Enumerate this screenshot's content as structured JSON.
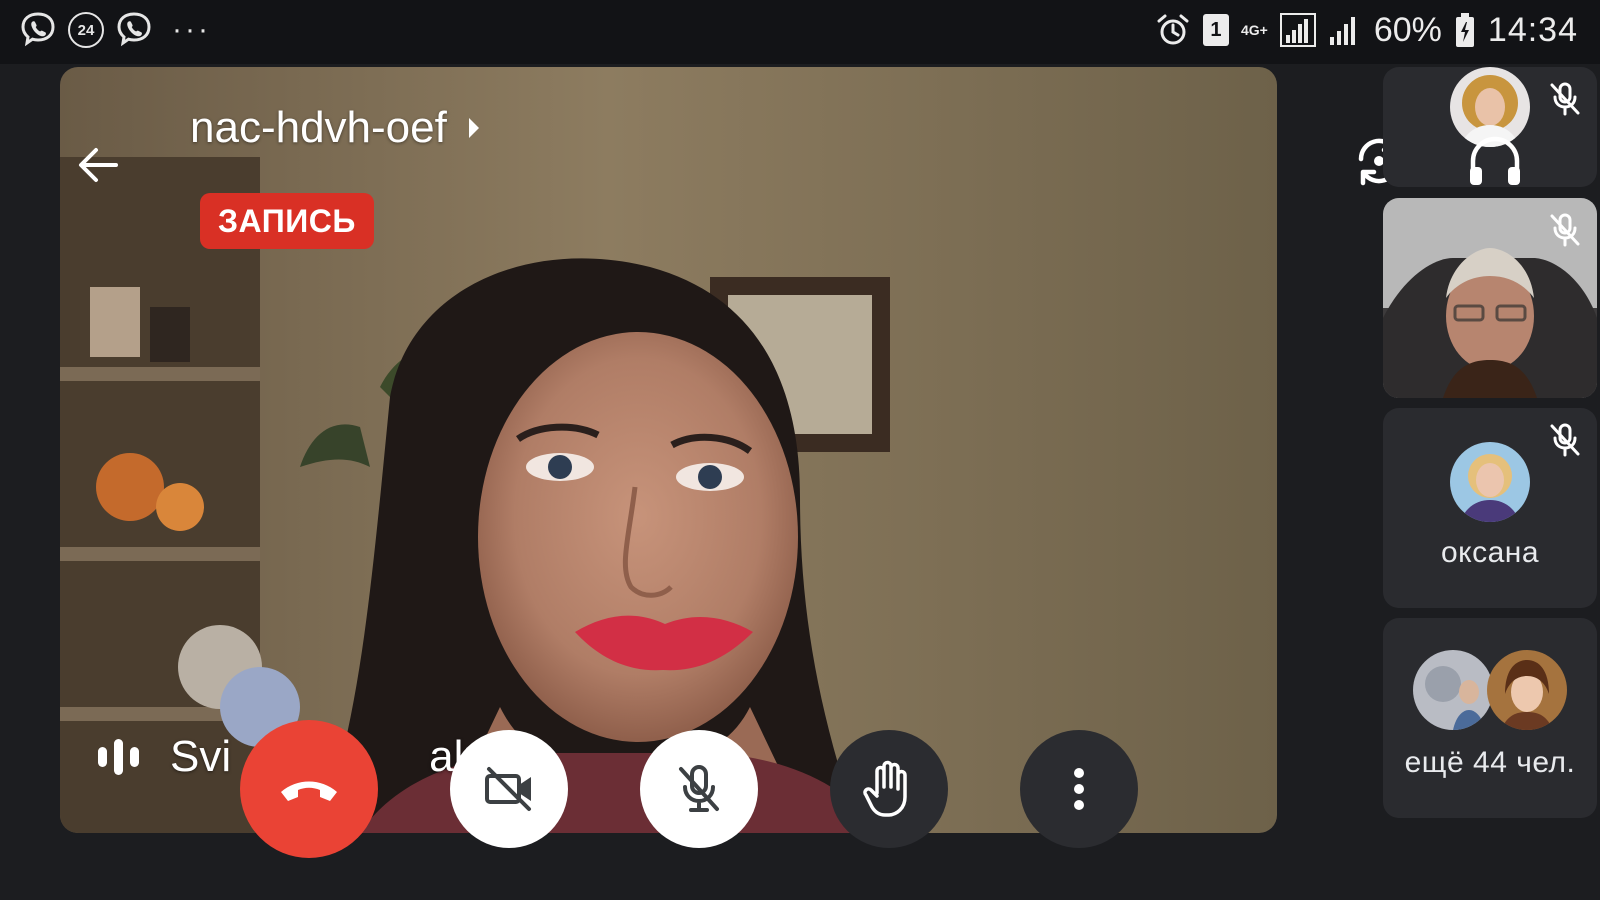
{
  "status_bar": {
    "left_icons": [
      "viber-icon",
      "badge-24-icon",
      "viber-icon"
    ],
    "badge_text": "24",
    "overflow": "···",
    "sim_slot": "1",
    "network_type": "4G+",
    "battery_percent_text": "60%",
    "time": "14:34"
  },
  "meeting": {
    "code": "nac-hdvh-oef",
    "recording_label": "ЗАПИСЬ",
    "speaker_name": "Svitlana Datsalnyuk",
    "speaker_name_visible_start": "Svi",
    "speaker_name_visible_end": "alny"
  },
  "controls": {
    "end_call": "end-call",
    "camera": "camera-off",
    "microphone": "mic-off",
    "raise_hand": "raise-hand",
    "more": "more-options"
  },
  "participants": [
    {
      "label": "",
      "muted": true,
      "has_video": false
    },
    {
      "label": "",
      "muted": true,
      "has_video": true
    },
    {
      "label": "оксана",
      "muted": true,
      "has_video": false
    },
    {
      "label": "ещё 44 чел.",
      "muted": false,
      "has_video": false
    }
  ],
  "colors": {
    "background": "#1c1d20",
    "end_call": "#ea4335",
    "recording": "#d93025",
    "tile": "#2a2b2f",
    "control_dark": "#2b2c30"
  }
}
